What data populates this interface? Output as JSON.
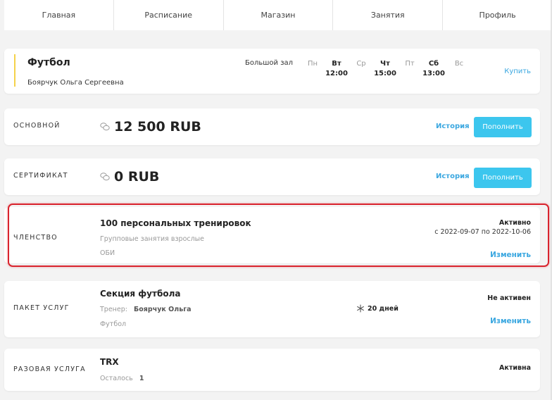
{
  "nav": {
    "items": [
      {
        "label": "Главная"
      },
      {
        "label": "Расписание"
      },
      {
        "label": "Магазин"
      },
      {
        "label": "Занятия"
      },
      {
        "label": "Профиль"
      }
    ]
  },
  "class_card": {
    "title": "Футбол",
    "trainer": "Боярчук Ольга Сергеевна",
    "hall": "Большой зал",
    "days": [
      {
        "name": "Пн",
        "time": ""
      },
      {
        "name": "Вт",
        "time": "12:00"
      },
      {
        "name": "Ср",
        "time": ""
      },
      {
        "name": "Чт",
        "time": "15:00"
      },
      {
        "name": "Пт",
        "time": ""
      },
      {
        "name": "Сб",
        "time": "13:00"
      },
      {
        "name": "Вс",
        "time": ""
      }
    ],
    "buy_label": "Купить"
  },
  "balances": [
    {
      "label": "ОСНОВНОЙ",
      "amount": "12 500 RUB",
      "history": "История",
      "topup": "Пополнить"
    },
    {
      "label": "СЕРТИФИКАТ",
      "amount": "0 RUB",
      "history": "История",
      "topup": "Пополнить"
    }
  ],
  "membership": {
    "label": "ЧЛЕНСТВО",
    "title": "100 персональных тренировок",
    "subtitle": "Групповые занятия взрослые",
    "tag": "ОБИ",
    "status": "Активно",
    "dates": "с 2022-09-07 по 2022-10-06",
    "change": "Изменить"
  },
  "package": {
    "label": "ПАКЕТ УСЛУГ",
    "title": "Секция футбола",
    "trainer_label": "Тренер:",
    "trainer_name": "Боярчук Ольга",
    "tag": "Футбол",
    "freeze": "20 дней",
    "status": "Не активен",
    "change": "Изменить"
  },
  "single": {
    "label": "РАЗОВАЯ УСЛУГА",
    "title": "TRX",
    "remaining_label": "Осталось",
    "remaining_value": "1",
    "status": "Активна"
  },
  "colors": {
    "accent": "#3cc6ee",
    "link": "#3aa7e0",
    "highlight": "#d9232d",
    "bar": "#f5d24a"
  }
}
